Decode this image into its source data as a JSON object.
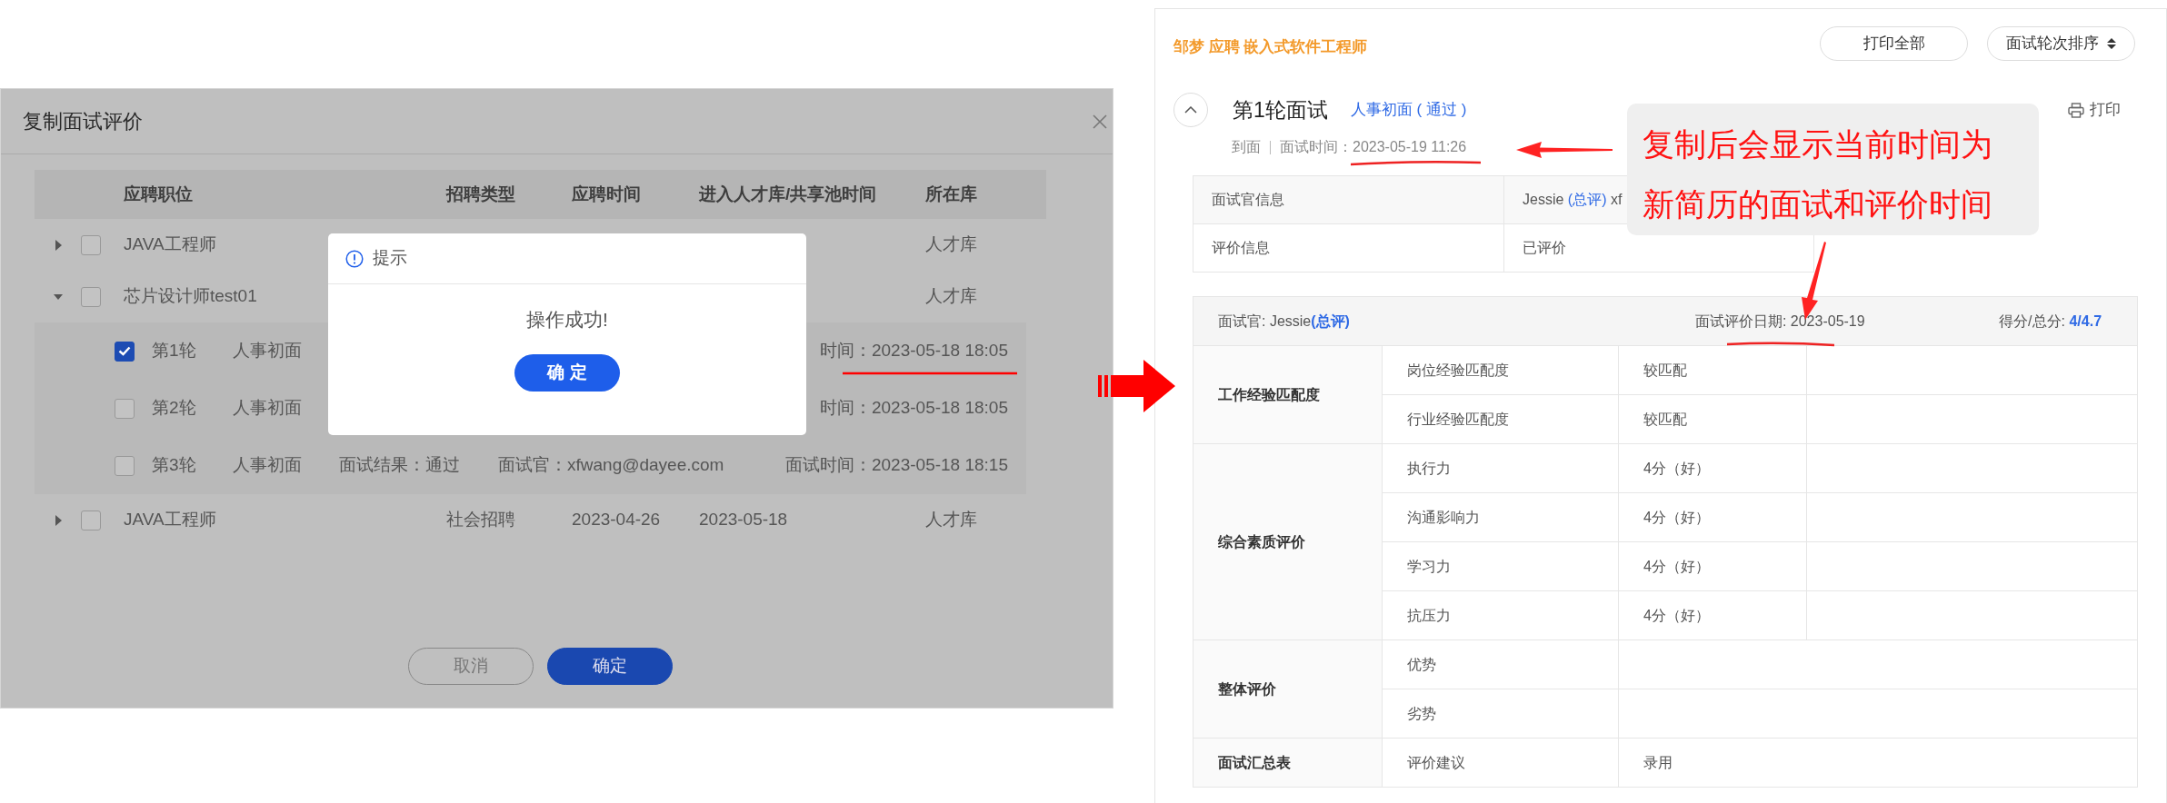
{
  "copy_dialog": {
    "title": "复制面试评价",
    "columns": [
      "应聘职位",
      "招聘类型",
      "应聘时间",
      "进入人才库/共享池时间",
      "所在库"
    ],
    "rows": [
      {
        "expanded": false,
        "checked": false,
        "position": "JAVA工程师",
        "library": "人才库"
      },
      {
        "expanded": true,
        "checked": false,
        "position": "芯片设计师test01",
        "library": "人才库",
        "children": [
          {
            "checked": true,
            "round": "第1轮",
            "type": "人事初面",
            "time": "时间：2023-05-18 18:05"
          },
          {
            "checked": false,
            "round": "第2轮",
            "type": "人事初面",
            "time": "时间：2023-05-18 18:05"
          },
          {
            "checked": false,
            "round": "第3轮",
            "type": "人事初面",
            "result": "面试结果：通过",
            "interviewer": "面试官：xfwang@dayee.com",
            "time": "面试时间：2023-05-18 18:15"
          }
        ]
      },
      {
        "expanded": false,
        "checked": false,
        "position": "JAVA工程师",
        "recruit_type": "社会招聘",
        "apply_date": "2023-04-26",
        "enter_date": "2023-05-18",
        "library": "人才库"
      }
    ],
    "buttons": [
      {
        "label": "取消",
        "kind": "secondary"
      },
      {
        "label": "确定",
        "kind": "primary"
      }
    ]
  },
  "alert": {
    "title": "提示",
    "message": "操作成功!",
    "button": "确 定"
  },
  "resume": {
    "title": "邹梦 应聘 嵌入式软件工程师",
    "buttons": [
      "打印全部",
      "面试轮次排序"
    ],
    "round": {
      "expanded": true,
      "title": "第1轮面试",
      "tag": "人事初面 ( 通过 )",
      "print": "打印",
      "status": "到面",
      "time_label": "面试时间：",
      "time": "2023-05-19 11:26",
      "info": [
        {
          "label": "面试官信息",
          "value": "Jessie",
          "role": "(总评)",
          "extra": "xf"
        },
        {
          "label": "评价信息",
          "value": "已评价"
        }
      ],
      "evaluation": {
        "interviewer_label": "面试官: Jessie",
        "role": "(总评)",
        "date_label": "面试评价日期:",
        "date": "2023-05-19",
        "score_label": "得分/总分:",
        "score": "4/4.7",
        "groups": [
          {
            "name": "工作经验匹配度",
            "kind": "score",
            "items": [
              {
                "name": "岗位经验匹配度",
                "value": "较匹配"
              },
              {
                "name": "行业经验匹配度",
                "value": "较匹配"
              }
            ]
          },
          {
            "name": "综合素质评价",
            "kind": "score",
            "items": [
              {
                "name": "执行力",
                "value": "4分（好）"
              },
              {
                "name": "沟通影响力",
                "value": "4分（好）"
              },
              {
                "name": "学习力",
                "value": "4分（好）"
              },
              {
                "name": "抗压力",
                "value": "4分（好）"
              }
            ]
          },
          {
            "name": "整体评价",
            "kind": "text",
            "items": [
              {
                "name": "优势"
              },
              {
                "name": "劣势"
              }
            ]
          },
          {
            "name": "面试汇总表",
            "kind": "text",
            "items": [
              {
                "name": "评价建议",
                "value": "录用"
              }
            ]
          }
        ]
      }
    }
  },
  "annotation": {
    "lines": [
      "复制后会显示当前时间为",
      "新简历的面试和评价时间"
    ]
  }
}
